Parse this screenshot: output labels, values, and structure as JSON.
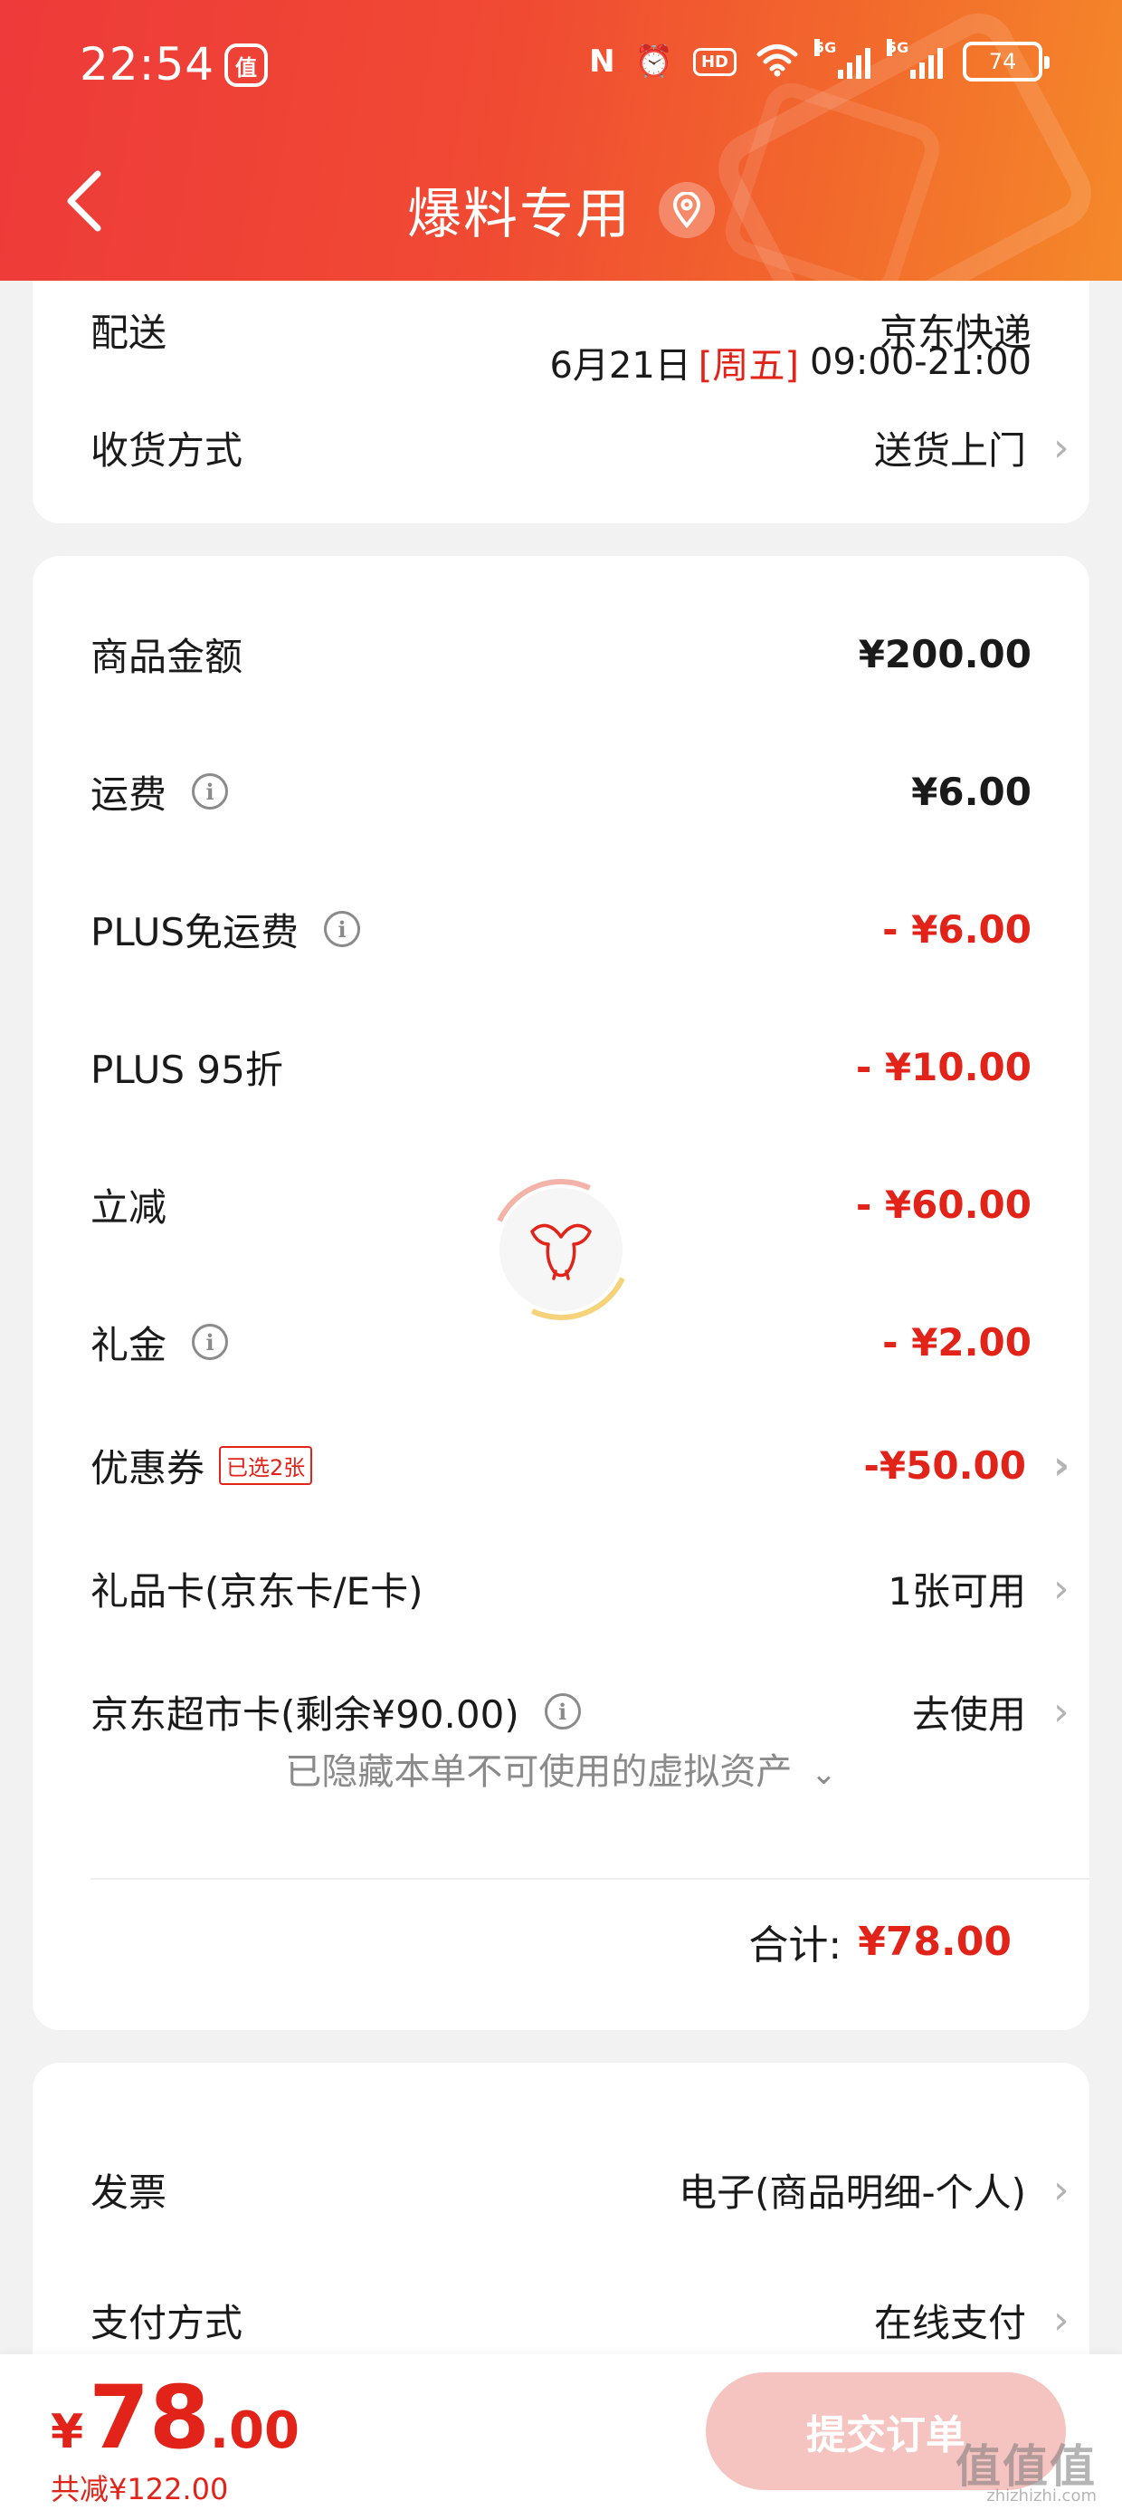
{
  "status_bar": {
    "time": "22:54",
    "app_icon": "值",
    "nfc": "N",
    "hd": "HD",
    "net1": "5G",
    "net2": "5G",
    "battery": "74"
  },
  "nav": {
    "title": "爆料专用"
  },
  "delivery": {
    "clipped_label": "配送",
    "clipped_value": "京东快递",
    "date": "6月21日",
    "weekday": "[周五]",
    "time_range": "09:00-21:00",
    "receive_label": "收货方式",
    "receive_value": "送货上门"
  },
  "prices": {
    "goods_label": "商品金额",
    "goods_value": "¥200.00",
    "shipping_label": "运费",
    "shipping_value": "¥6.00",
    "plus_free_label": "PLUS免运费",
    "plus_free_value": "- ¥6.00",
    "plus95_label": "PLUS 95折",
    "plus95_value": "- ¥10.00",
    "instant_label": "立减",
    "instant_value": "- ¥60.00",
    "gift_money_label": "礼金",
    "gift_money_value": "- ¥2.00",
    "coupon_label": "优惠券",
    "coupon_badge": "已选2张",
    "coupon_value": "-¥50.00",
    "giftcard_label": "礼品卡(京东卡/E卡)",
    "giftcard_value": "1张可用",
    "supercard_label": "京东超市卡(剩余¥90.00)",
    "supercard_value": "去使用",
    "hidden_assets": "已隐藏本单不可使用的虚拟资产",
    "total_label": "合计:",
    "total_value": "¥78.00"
  },
  "extra": {
    "invoice_label": "发票",
    "invoice_value": "电子(商品明细-个人)",
    "payment_label": "支付方式",
    "payment_value": "在线支付"
  },
  "bottom": {
    "currency": "¥",
    "price_int": "78",
    "price_dec": ".00",
    "saved": "共减¥122.00",
    "submit": "提交订单",
    "watermark": "值值值",
    "watermark_sub": "zhizhizhi.com"
  },
  "colors": {
    "accent_red": "#e2231a",
    "header_start": "#ee3a3a",
    "header_end": "#f5892a",
    "submit_disabled": "#f6c4c0"
  }
}
